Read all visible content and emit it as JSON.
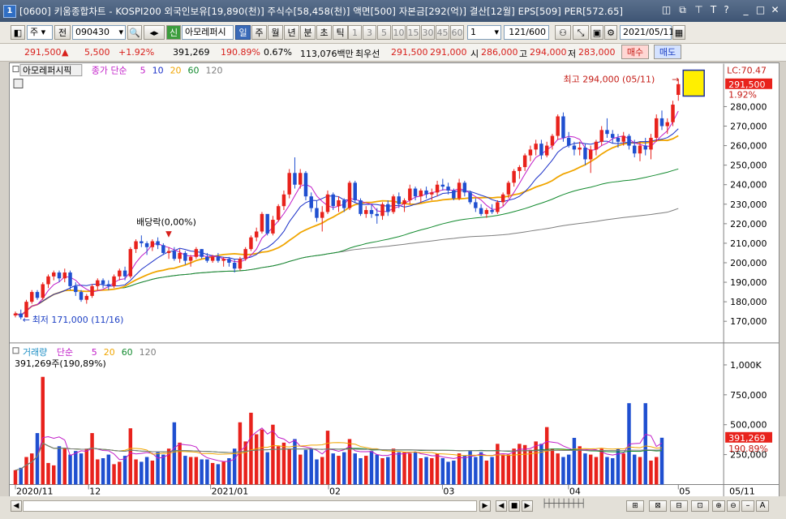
{
  "title_bar": {
    "window_number": "1",
    "title": "[0600] 키움종합차트 - KOSPI200 외국인보유[19,890(천)] 주식수[58,458(천)] 액면[500] 자본금[292(억)] 결산[12월] EPS[509] PER[572.65]"
  },
  "toolbar": {
    "period_label": "주",
    "prev_label": "전",
    "stock_code": "090430",
    "shin_label": "신",
    "stock_name": "아모레퍼시",
    "period_buttons": [
      "일",
      "주",
      "월",
      "년",
      "분",
      "초",
      "틱"
    ],
    "interval_buttons": [
      "1",
      "3",
      "5",
      "10",
      "15",
      "30",
      "45",
      "60"
    ],
    "interval_value": "1",
    "count": "121/600",
    "date": "2021/05/11"
  },
  "quote": {
    "price": "291,500",
    "arrow": "▲",
    "change": "5,500",
    "change_pct": "+1.92%",
    "volume": "391,269",
    "volume_pct": "190.89%",
    "turnover": "0.67%",
    "amount": "113,076백만",
    "best_label": "최우선",
    "ask": "291,500",
    "bid": "291,000",
    "open_label": "시",
    "open": "286,000",
    "high_label": "고",
    "high": "294,000",
    "low_label": "저",
    "low": "283,000",
    "buy_label": "매수",
    "sell_label": "매도"
  },
  "price_legend": {
    "stock": "아모레퍼시픽",
    "series": "종가 단순",
    "ma": [
      "5",
      "10",
      "20",
      "60",
      "120"
    ]
  },
  "volume_legend": {
    "name": "거래량",
    "series": "단순",
    "ma": [
      "5",
      "20",
      "60",
      "120"
    ],
    "current": "391,269주(190,89%)"
  },
  "annotations": {
    "high": "최고 294,000 (05/11)",
    "low": "최저 171,000 (11/16)",
    "dividend": "배당락(0,00%)",
    "lc": "LC:70.47",
    "price_tag": "291,500",
    "pct_tag": "1.92%",
    "vol_tag": "391,269",
    "vol_pct_tag": "190.89%"
  },
  "colors": {
    "up": "#e8221c",
    "down": "#1f4fd0",
    "ma5": "#c11cc8",
    "ma10": "#1a2fc8",
    "ma20": "#f0a500",
    "ma60": "#128a2e",
    "ma120": "#7d7d7d"
  },
  "chart_data": {
    "type": "candlestick",
    "price_axis": {
      "ticks": [
        "280,000",
        "270,000",
        "260,000",
        "250,000",
        "240,000",
        "230,000",
        "220,000",
        "210,000",
        "200,000",
        "190,000",
        "180,000",
        "170,000"
      ],
      "ylim": [
        161000,
        297000
      ]
    },
    "volume_axis": {
      "ticks": [
        "1,000K",
        "750,000",
        "500,000",
        "250,000"
      ],
      "ylim": [
        0,
        1150000
      ]
    },
    "x_ticks": [
      "2020/11",
      "12",
      "2021/01",
      "02",
      "03",
      "04",
      "05",
      "05/11"
    ],
    "candles": [
      [
        173000,
        175000,
        172000,
        174000
      ],
      [
        174000,
        176000,
        171000,
        172000
      ],
      [
        172000,
        181000,
        172000,
        180000
      ],
      [
        180000,
        186000,
        179000,
        185000
      ],
      [
        185000,
        186000,
        181000,
        182000
      ],
      [
        182000,
        190000,
        181000,
        189000
      ],
      [
        189000,
        194000,
        187000,
        193000
      ],
      [
        193000,
        196000,
        191000,
        195000
      ],
      [
        195000,
        196000,
        190000,
        192000
      ],
      [
        192000,
        197000,
        190000,
        195000
      ],
      [
        195000,
        196000,
        186000,
        188000
      ],
      [
        188000,
        190000,
        183000,
        185000
      ],
      [
        185000,
        186000,
        180000,
        181000
      ],
      [
        181000,
        184000,
        179000,
        183000
      ],
      [
        183000,
        189000,
        182000,
        188000
      ],
      [
        188000,
        192000,
        186000,
        191000
      ],
      [
        191000,
        192000,
        187000,
        189000
      ],
      [
        189000,
        191000,
        186000,
        188000
      ],
      [
        188000,
        194000,
        187000,
        193000
      ],
      [
        193000,
        197000,
        191000,
        196000
      ],
      [
        196000,
        198000,
        191000,
        193000
      ],
      [
        193000,
        208000,
        192000,
        207000
      ],
      [
        207000,
        212000,
        205000,
        211000
      ],
      [
        211000,
        214000,
        208000,
        210000
      ],
      [
        210000,
        211000,
        204000,
        208000
      ],
      [
        208000,
        212000,
        206000,
        211000
      ],
      [
        211000,
        213000,
        207000,
        209000
      ],
      [
        209000,
        210000,
        204000,
        205000
      ],
      [
        205000,
        208000,
        202000,
        206000
      ],
      [
        206000,
        208000,
        201000,
        202000
      ],
      [
        202000,
        207000,
        200000,
        205000
      ],
      [
        205000,
        206000,
        199000,
        201000
      ],
      [
        201000,
        204000,
        198000,
        203000
      ],
      [
        203000,
        208000,
        202000,
        207000
      ],
      [
        207000,
        207000,
        202000,
        203000
      ],
      [
        203000,
        205000,
        200000,
        201000
      ],
      [
        201000,
        204000,
        200000,
        203000
      ],
      [
        203000,
        205000,
        200000,
        201000
      ],
      [
        201000,
        203000,
        198000,
        202000
      ],
      [
        202000,
        203000,
        198000,
        200000
      ],
      [
        200000,
        202000,
        195000,
        197000
      ],
      [
        197000,
        203000,
        196000,
        202000
      ],
      [
        202000,
        208000,
        201000,
        207000
      ],
      [
        207000,
        214000,
        206000,
        213000
      ],
      [
        213000,
        218000,
        211000,
        216000
      ],
      [
        216000,
        226000,
        215000,
        225000
      ],
      [
        225000,
        224000,
        214000,
        215000
      ],
      [
        215000,
        224000,
        214000,
        222000
      ],
      [
        222000,
        230000,
        221000,
        229000
      ],
      [
        229000,
        237000,
        227000,
        235000
      ],
      [
        235000,
        248000,
        233000,
        246000
      ],
      [
        246000,
        254000,
        238000,
        240000
      ],
      [
        240000,
        248000,
        238000,
        246000
      ],
      [
        246000,
        247000,
        232000,
        234000
      ],
      [
        234000,
        236000,
        226000,
        228000
      ],
      [
        228000,
        232000,
        221000,
        223000
      ],
      [
        223000,
        229000,
        216000,
        226000
      ],
      [
        226000,
        237000,
        225000,
        235000
      ],
      [
        235000,
        236000,
        227000,
        229000
      ],
      [
        229000,
        234000,
        226000,
        232000
      ],
      [
        232000,
        233000,
        226000,
        228000
      ],
      [
        228000,
        242000,
        227000,
        241000
      ],
      [
        241000,
        242000,
        231000,
        232000
      ],
      [
        232000,
        233000,
        224000,
        225000
      ],
      [
        225000,
        229000,
        223000,
        227000
      ],
      [
        227000,
        230000,
        223000,
        225000
      ],
      [
        225000,
        228000,
        220000,
        224000
      ],
      [
        224000,
        231000,
        222000,
        230000
      ],
      [
        230000,
        232000,
        224000,
        226000
      ],
      [
        226000,
        235000,
        225000,
        234000
      ],
      [
        234000,
        236000,
        228000,
        230000
      ],
      [
        230000,
        233000,
        226000,
        232000
      ],
      [
        232000,
        240000,
        230000,
        238000
      ],
      [
        238000,
        239000,
        232000,
        234000
      ],
      [
        234000,
        238000,
        231000,
        237000
      ],
      [
        237000,
        239000,
        233000,
        235000
      ],
      [
        235000,
        238000,
        232000,
        236000
      ],
      [
        236000,
        242000,
        234000,
        240000
      ],
      [
        240000,
        243000,
        237000,
        239000
      ],
      [
        239000,
        241000,
        235000,
        237000
      ],
      [
        237000,
        238000,
        232000,
        233000
      ],
      [
        233000,
        243000,
        232000,
        241000
      ],
      [
        241000,
        242000,
        234000,
        236000
      ],
      [
        236000,
        237000,
        230000,
        231000
      ],
      [
        231000,
        233000,
        226000,
        228000
      ],
      [
        228000,
        230000,
        224000,
        225000
      ],
      [
        225000,
        228000,
        223000,
        227000
      ],
      [
        227000,
        230000,
        225000,
        226000
      ],
      [
        226000,
        232000,
        225000,
        231000
      ],
      [
        231000,
        236000,
        229000,
        235000
      ],
      [
        235000,
        242000,
        233000,
        241000
      ],
      [
        241000,
        248000,
        239000,
        247000
      ],
      [
        247000,
        250000,
        243000,
        249000
      ],
      [
        249000,
        256000,
        247000,
        255000
      ],
      [
        255000,
        260000,
        252000,
        258000
      ],
      [
        258000,
        263000,
        255000,
        261000
      ],
      [
        261000,
        263000,
        253000,
        255000
      ],
      [
        255000,
        262000,
        254000,
        260000
      ],
      [
        260000,
        266000,
        258000,
        265000
      ],
      [
        265000,
        276000,
        263000,
        275000
      ],
      [
        275000,
        277000,
        262000,
        264000
      ],
      [
        264000,
        267000,
        259000,
        260000
      ],
      [
        260000,
        262000,
        255000,
        258000
      ],
      [
        258000,
        262000,
        255000,
        259000
      ],
      [
        259000,
        261000,
        250000,
        253000
      ],
      [
        253000,
        260000,
        246000,
        258000
      ],
      [
        258000,
        263000,
        255000,
        262000
      ],
      [
        262000,
        270000,
        260000,
        268000
      ],
      [
        268000,
        274000,
        264000,
        266000
      ],
      [
        266000,
        268000,
        261000,
        264000
      ],
      [
        264000,
        266000,
        259000,
        262000
      ],
      [
        262000,
        267000,
        260000,
        265000
      ],
      [
        265000,
        266000,
        258000,
        260000
      ],
      [
        260000,
        263000,
        254000,
        256000
      ],
      [
        256000,
        262000,
        252000,
        260000
      ],
      [
        260000,
        264000,
        255000,
        258000
      ],
      [
        258000,
        266000,
        253000,
        264000
      ],
      [
        264000,
        276000,
        262000,
        274000
      ],
      [
        274000,
        278000,
        268000,
        270000
      ],
      [
        270000,
        274000,
        266000,
        272000
      ],
      [
        272000,
        283000,
        270000,
        281000
      ],
      [
        286000,
        294000,
        283000,
        291500
      ]
    ],
    "volumes": [
      120,
      140,
      230,
      260,
      430,
      900,
      180,
      160,
      320,
      300,
      250,
      280,
      260,
      300,
      430,
      210,
      220,
      250,
      170,
      190,
      240,
      470,
      210,
      190,
      230,
      200,
      270,
      250,
      300,
      520,
      350,
      240,
      230,
      230,
      210,
      210,
      180,
      170,
      190,
      220,
      300,
      520,
      360,
      600,
      420,
      460,
      270,
      500,
      320,
      350,
      300,
      380,
      250,
      290,
      300,
      210,
      230,
      450,
      260,
      240,
      270,
      380,
      260,
      220,
      240,
      280,
      250,
      220,
      230,
      300,
      270,
      270,
      260,
      270,
      220,
      230,
      220,
      260,
      220,
      190,
      200,
      260,
      240,
      280,
      230,
      270,
      200,
      230,
      340,
      250,
      250,
      300,
      340,
      330,
      290,
      360,
      340,
      480,
      300,
      260,
      230,
      250,
      390,
      320,
      260,
      250,
      230,
      300,
      230,
      220,
      300,
      260,
      680,
      250,
      230,
      680,
      200,
      230,
      391
    ]
  }
}
